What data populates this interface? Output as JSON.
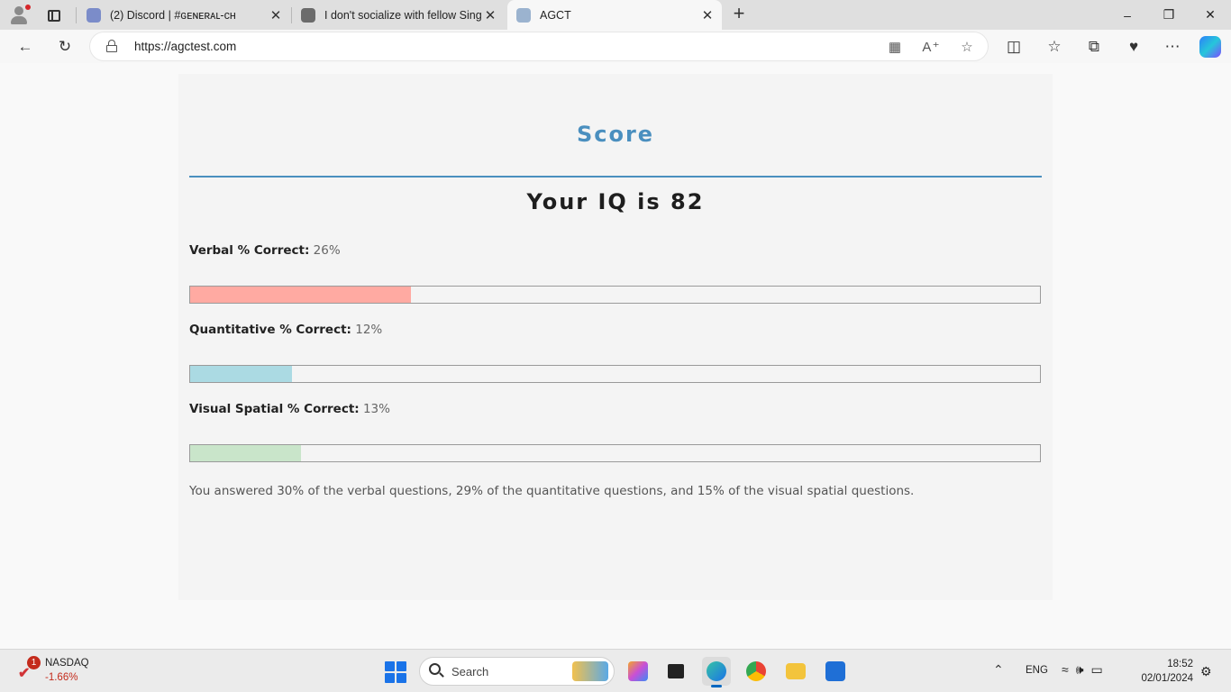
{
  "browser": {
    "tabs": [
      {
        "title": "(2) Discord | #ɢᴇɴᴇʀᴀʟ-ᴄʜ",
        "favicon": "discord-icon",
        "color": "#7b8cc9"
      },
      {
        "title": "I don't socialize with fellow Singa",
        "favicon": "link-icon",
        "color": "#6b6b6b"
      },
      {
        "title": "AGCT",
        "favicon": "globe-icon",
        "color": "#9bb3cf"
      }
    ],
    "new_tab_label": "+",
    "url": "https://agctest.com"
  },
  "page": {
    "heading": "Score",
    "iq_text": "Your IQ is 82",
    "metrics": [
      {
        "label": "Verbal % Correct:",
        "value": "26%",
        "percent": 26,
        "color": "#ffaaa2"
      },
      {
        "label": "Quantitative % Correct:",
        "value": "12%",
        "percent": 12,
        "color": "#abdae3"
      },
      {
        "label": "Visual Spatial % Correct:",
        "value": "13%",
        "percent": 13,
        "color": "#c9e5ca"
      }
    ],
    "summary": "You answered 30% of the verbal questions, 29% of the quantitative questions, and 15% of the visual spatial questions.",
    "accent_color": "#4a8fbf"
  },
  "taskbar": {
    "stock": {
      "name": "NASDAQ",
      "change": "-1.66%",
      "badge": "1"
    },
    "search_placeholder": "Search",
    "language": "ENG",
    "time": "18:52",
    "date": "02/01/2024"
  }
}
